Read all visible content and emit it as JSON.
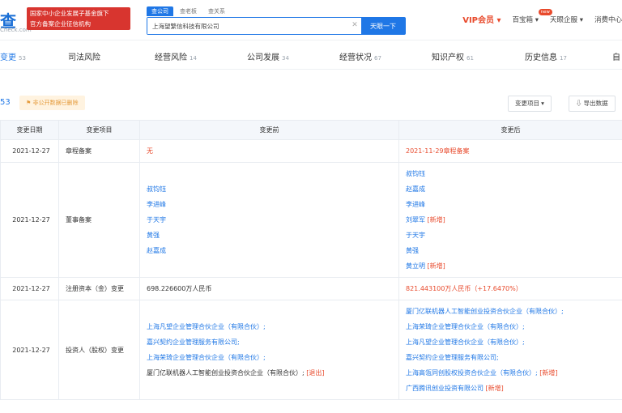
{
  "header": {
    "logo": "查",
    "logo_sub": "Check.com",
    "banner_line1": "国家中小企业发展子基金旗下",
    "banner_line2": "官方备案企业征信机构",
    "search_tabs": [
      "查公司",
      "查老板",
      "查关系"
    ],
    "search_value": "上海望繁信科技有限公司",
    "search_button": "天眼一下",
    "nav": {
      "vip": "VIP会员",
      "baiyin": "百宝箱",
      "baiyin_badge": "new",
      "tianyan": "天眼企服",
      "xiaofei": "消费中心"
    }
  },
  "tabs": [
    {
      "label": "变更",
      "count": "53"
    },
    {
      "label": "司法风险",
      "count": ""
    },
    {
      "label": "经营风险",
      "count": "14"
    },
    {
      "label": "公司发展",
      "count": "34"
    },
    {
      "label": "经营状况",
      "count": "67"
    },
    {
      "label": "知识产权",
      "count": "61"
    },
    {
      "label": "历史信息",
      "count": "17"
    },
    {
      "label": "自",
      "count": ""
    }
  ],
  "toolbar": {
    "title": "53",
    "notice": "⚑ 非公开数据已删除",
    "filter": "变更项目 ▾",
    "export": "⇩ 导出数据"
  },
  "table": {
    "headers": [
      "变更日期",
      "变更项目",
      "变更前",
      "变更后"
    ],
    "rows": [
      {
        "date": "2021-12-27",
        "item": "章程备案",
        "before": [
          {
            "text": "无",
            "cls": "red"
          }
        ],
        "after": [
          {
            "text": "2021-11-29章程备案",
            "cls": "red"
          }
        ]
      },
      {
        "date": "2021-12-27",
        "item": "董事备案",
        "before": [
          {
            "text": "叔钧钰",
            "cls": "link"
          },
          {
            "text": "李进峰",
            "cls": "link"
          },
          {
            "text": "于天宇",
            "cls": "link"
          },
          {
            "text": "黄强",
            "cls": "link"
          },
          {
            "text": "赵嘉成",
            "cls": "link"
          }
        ],
        "after": [
          {
            "text": "叔钧钰",
            "cls": "link"
          },
          {
            "text": "赵嘉成",
            "cls": "link"
          },
          {
            "text": "李进峰",
            "cls": "link"
          },
          {
            "text": "刘翠军",
            "cls": "link",
            "tag": "[新增]"
          },
          {
            "text": "于天宇",
            "cls": "link"
          },
          {
            "text": "黄强",
            "cls": "link"
          },
          {
            "text": "黄立明",
            "cls": "link",
            "tag": "[新增]"
          }
        ]
      },
      {
        "date": "2021-12-27",
        "item": "注册资本（金）变更",
        "before": [
          {
            "text": "698.226600万人民币",
            "cls": ""
          }
        ],
        "after": [
          {
            "text": "821.443100万人民币（+17.6470%）",
            "cls": "red"
          }
        ]
      },
      {
        "date": "2021-12-27",
        "item": "投资人（股权）变更",
        "before": [
          {
            "text": "上海凡望企业管理合伙企业（有限合伙）;",
            "cls": "link"
          },
          {
            "text": "嘉兴契约企业管理服务有限公司;",
            "cls": "link"
          },
          {
            "text": "上海荣琦企业管理合伙企业（有限合伙）;",
            "cls": "link"
          },
          {
            "text": "厦门亿联机器人工智能创业投资合伙企业（有限合伙）;",
            "cls": "",
            "tag": "[退出]"
          }
        ],
        "after": [
          {
            "text": "厦门亿联机器人工智能创业投资合伙企业（有限合伙）;",
            "cls": "link"
          },
          {
            "text": "上海荣琦企业管理合伙企业（有限合伙）;",
            "cls": "link"
          },
          {
            "text": "上海凡望企业管理合伙企业（有限合伙）;",
            "cls": "link"
          },
          {
            "text": "嘉兴契约企业管理服务有限公司;",
            "cls": "link"
          },
          {
            "text": "上海高瓴同创股权投资合伙企业（有限合伙）;",
            "cls": "link",
            "tag": "[新增]"
          },
          {
            "text": "广西腾讯创业投资有限公司",
            "cls": "link",
            "tag": "[新增]"
          }
        ]
      }
    ]
  }
}
